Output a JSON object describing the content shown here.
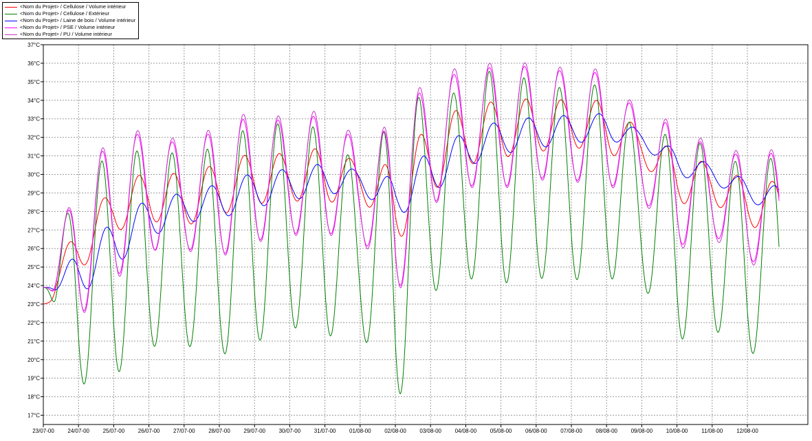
{
  "chart_data": {
    "type": "line",
    "title": "",
    "xlabel": "",
    "ylabel": "",
    "ylim": [
      16.5,
      37
    ],
    "y_ticks": [
      "17°C",
      "18°C",
      "19°C",
      "20°C",
      "21°C",
      "22°C",
      "23°C",
      "24°C",
      "25°C",
      "26°C",
      "27°C",
      "28°C",
      "29°C",
      "30°C",
      "31°C",
      "32°C",
      "33°C",
      "34°C",
      "35°C",
      "36°C",
      "37°C"
    ],
    "y_tick_values": [
      17,
      18,
      19,
      20,
      21,
      22,
      23,
      24,
      25,
      26,
      27,
      28,
      29,
      30,
      31,
      32,
      33,
      34,
      35,
      36,
      37
    ],
    "x_ticks": [
      "23/07-00",
      "24/07-00",
      "25/07-00",
      "26/07-00",
      "27/07-00",
      "28/07-00",
      "29/07-00",
      "30/07-00",
      "31/07-00",
      "01/08-00",
      "02/08-00",
      "03/08-00",
      "04/08-00",
      "05/08-00",
      "06/08-00",
      "07/08-00",
      "08/08-00",
      "09/08-00",
      "10/08-00",
      "11/08-00",
      "12/08-00"
    ],
    "x_range_days": [
      0,
      20.9
    ],
    "grid": true,
    "legend_position": "top-left",
    "series": [
      {
        "name": "<Nom du Projet> / Cellulose / Volume intérieur",
        "color": "#ff0000",
        "phase": 0.71,
        "min": [
          23.0,
          24.7,
          26.9,
          27.5,
          27.2,
          27.8,
          28.4,
          28.6,
          28.4,
          28.9,
          26.1,
          29.0,
          30.5,
          30.9,
          31.2,
          31.5,
          31.1,
          30.7,
          28.4,
          28.5,
          27.2,
          26.9
        ],
        "max": [
          23.9,
          27.2,
          29.3,
          30.2,
          30.0,
          30.6,
          31.2,
          31.1,
          31.5,
          30.6,
          30.5,
          32.8,
          33.7,
          34.0,
          34.1,
          34.0,
          34.0,
          32.3,
          31.2,
          30.5,
          29.7,
          29.6
        ]
      },
      {
        "name": "<Nom du Projet> / Cellulose / Extérieur",
        "color": "#008000",
        "phase": 0.66,
        "min": [
          23.9,
          18.6,
          19.1,
          20.7,
          20.8,
          20.2,
          20.9,
          21.8,
          21.2,
          21.7,
          17.2,
          23.6,
          24.4,
          24.1,
          24.4,
          24.3,
          24.4,
          24.1,
          21.0,
          21.7,
          20.3,
          20.5
        ],
        "max": [
          23.9,
          29.8,
          31.2,
          31.3,
          31.1,
          31.5,
          32.8,
          32.7,
          32.5,
          30.3,
          33.3,
          34.6,
          34.3,
          36.2,
          34.7,
          34.7,
          34.9,
          31.7,
          32.4,
          31.3,
          30.4,
          31.1
        ]
      },
      {
        "name": "<Nom du Projet> / Laine de bois / Volume intérieur",
        "color": "#0000ff",
        "phase": 0.78,
        "min": [
          23.9,
          23.4,
          25.0,
          26.6,
          27.4,
          27.6,
          28.2,
          28.6,
          28.9,
          29.1,
          27.6,
          28.9,
          30.4,
          31.1,
          31.4,
          31.7,
          31.8,
          31.6,
          29.9,
          29.6,
          28.5,
          28.0
        ],
        "max": [
          23.9,
          25.8,
          27.5,
          28.7,
          29.0,
          29.5,
          30.1,
          30.3,
          30.6,
          30.2,
          29.8,
          31.3,
          32.3,
          32.9,
          33.1,
          33.2,
          33.3,
          32.3,
          31.3,
          30.5,
          29.7,
          29.3
        ]
      },
      {
        "name": "<Nom du Projet> / PSE / Volume intérieur",
        "color": "#ff00ff",
        "phase": 0.67,
        "min": [
          23.9,
          22.3,
          24.4,
          25.9,
          26.0,
          25.6,
          26.4,
          26.8,
          26.8,
          26.8,
          23.2,
          28.4,
          29.4,
          29.3,
          29.8,
          29.7,
          29.5,
          28.8,
          26.1,
          26.8,
          25.3,
          25.2
        ],
        "max": [
          23.9,
          29.9,
          31.9,
          32.3,
          31.5,
          32.5,
          33.2,
          32.8,
          33.3,
          31.6,
          32.7,
          35.2,
          35.5,
          35.9,
          35.8,
          35.5,
          35.5,
          33.0,
          32.7,
          31.3,
          31.0,
          31.2
        ]
      },
      {
        "name": "<Nom du Projet> / PU / Volume intérieur",
        "color": "#cc33cc",
        "phase": 0.68,
        "min": [
          23.9,
          22.2,
          24.2,
          25.9,
          25.9,
          25.5,
          26.3,
          26.7,
          26.7,
          26.7,
          23.0,
          28.3,
          29.3,
          29.2,
          29.7,
          29.6,
          29.4,
          28.7,
          25.9,
          26.6,
          25.1,
          25.1
        ],
        "max": [
          23.9,
          30.0,
          32.1,
          32.5,
          31.7,
          32.7,
          33.5,
          33.0,
          33.6,
          31.8,
          32.9,
          35.5,
          35.8,
          36.1,
          36.0,
          35.7,
          35.7,
          33.2,
          32.9,
          31.5,
          31.2,
          31.4
        ]
      }
    ]
  }
}
